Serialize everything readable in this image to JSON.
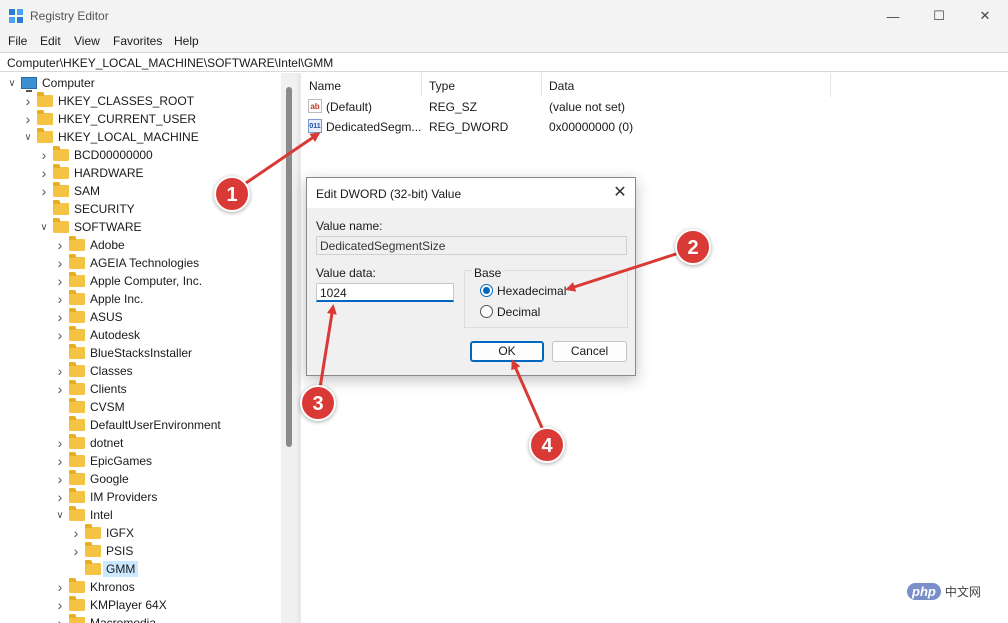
{
  "window": {
    "title": "Registry Editor",
    "minimize_glyph": "—",
    "maximize_glyph": "☐",
    "close_glyph": "✕"
  },
  "menu": [
    "File",
    "Edit",
    "View",
    "Favorites",
    "Help"
  ],
  "address": "Computer\\HKEY_LOCAL_MACHINE\\SOFTWARE\\Intel\\GMM",
  "tree": {
    "items": [
      {
        "label": "Computer",
        "level": 0,
        "chevron": "open",
        "icon": "computer-icon"
      },
      {
        "label": "HKEY_CLASSES_ROOT",
        "level": 1,
        "chevron": "closed",
        "icon": "folder-icon"
      },
      {
        "label": "HKEY_CURRENT_USER",
        "level": 1,
        "chevron": "closed",
        "icon": "folder-icon"
      },
      {
        "label": "HKEY_LOCAL_MACHINE",
        "level": 1,
        "chevron": "open",
        "icon": "folder-icon"
      },
      {
        "label": "BCD00000000",
        "level": 2,
        "chevron": "closed",
        "icon": "folder-icon"
      },
      {
        "label": "HARDWARE",
        "level": 2,
        "chevron": "closed",
        "icon": "folder-icon"
      },
      {
        "label": "SAM",
        "level": 2,
        "chevron": "closed",
        "icon": "folder-icon"
      },
      {
        "label": "SECURITY",
        "level": 2,
        "chevron": "none",
        "icon": "folder-icon"
      },
      {
        "label": "SOFTWARE",
        "level": 2,
        "chevron": "open",
        "icon": "folder-icon"
      },
      {
        "label": "Adobe",
        "level": 3,
        "chevron": "closed",
        "icon": "folder-icon"
      },
      {
        "label": "AGEIA Technologies",
        "level": 3,
        "chevron": "closed",
        "icon": "folder-icon"
      },
      {
        "label": "Apple Computer, Inc.",
        "level": 3,
        "chevron": "closed",
        "icon": "folder-icon"
      },
      {
        "label": "Apple Inc.",
        "level": 3,
        "chevron": "closed",
        "icon": "folder-icon"
      },
      {
        "label": "ASUS",
        "level": 3,
        "chevron": "closed",
        "icon": "folder-icon"
      },
      {
        "label": "Autodesk",
        "level": 3,
        "chevron": "closed",
        "icon": "folder-icon"
      },
      {
        "label": "BlueStacksInstaller",
        "level": 3,
        "chevron": "none",
        "icon": "folder-icon"
      },
      {
        "label": "Classes",
        "level": 3,
        "chevron": "closed",
        "icon": "folder-icon"
      },
      {
        "label": "Clients",
        "level": 3,
        "chevron": "closed",
        "icon": "folder-icon"
      },
      {
        "label": "CVSM",
        "level": 3,
        "chevron": "none",
        "icon": "folder-icon"
      },
      {
        "label": "DefaultUserEnvironment",
        "level": 3,
        "chevron": "none",
        "icon": "folder-icon"
      },
      {
        "label": "dotnet",
        "level": 3,
        "chevron": "closed",
        "icon": "folder-icon"
      },
      {
        "label": "EpicGames",
        "level": 3,
        "chevron": "closed",
        "icon": "folder-icon"
      },
      {
        "label": "Google",
        "level": 3,
        "chevron": "closed",
        "icon": "folder-icon"
      },
      {
        "label": "IM Providers",
        "level": 3,
        "chevron": "closed",
        "icon": "folder-icon"
      },
      {
        "label": "Intel",
        "level": 3,
        "chevron": "open",
        "icon": "folder-icon"
      },
      {
        "label": "IGFX",
        "level": 4,
        "chevron": "closed",
        "icon": "folder-icon"
      },
      {
        "label": "PSIS",
        "level": 4,
        "chevron": "closed",
        "icon": "folder-icon"
      },
      {
        "label": "GMM",
        "level": 4,
        "chevron": "none",
        "icon": "folder-icon",
        "selected": true
      },
      {
        "label": "Khronos",
        "level": 3,
        "chevron": "closed",
        "icon": "folder-icon"
      },
      {
        "label": "KMPlayer 64X",
        "level": 3,
        "chevron": "closed",
        "icon": "folder-icon"
      },
      {
        "label": "Macromedia",
        "level": 3,
        "chevron": "closed",
        "icon": "folder-icon"
      }
    ]
  },
  "list": {
    "columns": [
      "Name",
      "Type",
      "Data"
    ],
    "rows": [
      {
        "icon": "string-value-icon",
        "icon_glyph": "ab",
        "name": "(Default)",
        "type": "REG_SZ",
        "data": "(value not set)"
      },
      {
        "icon": "binary-value-icon",
        "icon_glyph": "011",
        "name": "DedicatedSegm...",
        "type": "REG_DWORD",
        "data": "0x00000000 (0)"
      }
    ]
  },
  "dialog": {
    "title": "Edit DWORD (32-bit) Value",
    "close_glyph": "✕",
    "value_name_label": "Value name:",
    "value_name": "DedicatedSegmentSize",
    "value_data_label": "Value data:",
    "value_data": "1024",
    "base_label": "Base",
    "hex_label": "Hexadecimal",
    "dec_label": "Decimal",
    "base_selected": "Hexadecimal",
    "ok_label": "OK",
    "cancel_label": "Cancel"
  },
  "annotations": [
    "1",
    "2",
    "3",
    "4"
  ],
  "annotation_color": "#d93a35",
  "accent_color": "#0067c0",
  "watermark": {
    "logo": "php",
    "text": "中文网"
  }
}
